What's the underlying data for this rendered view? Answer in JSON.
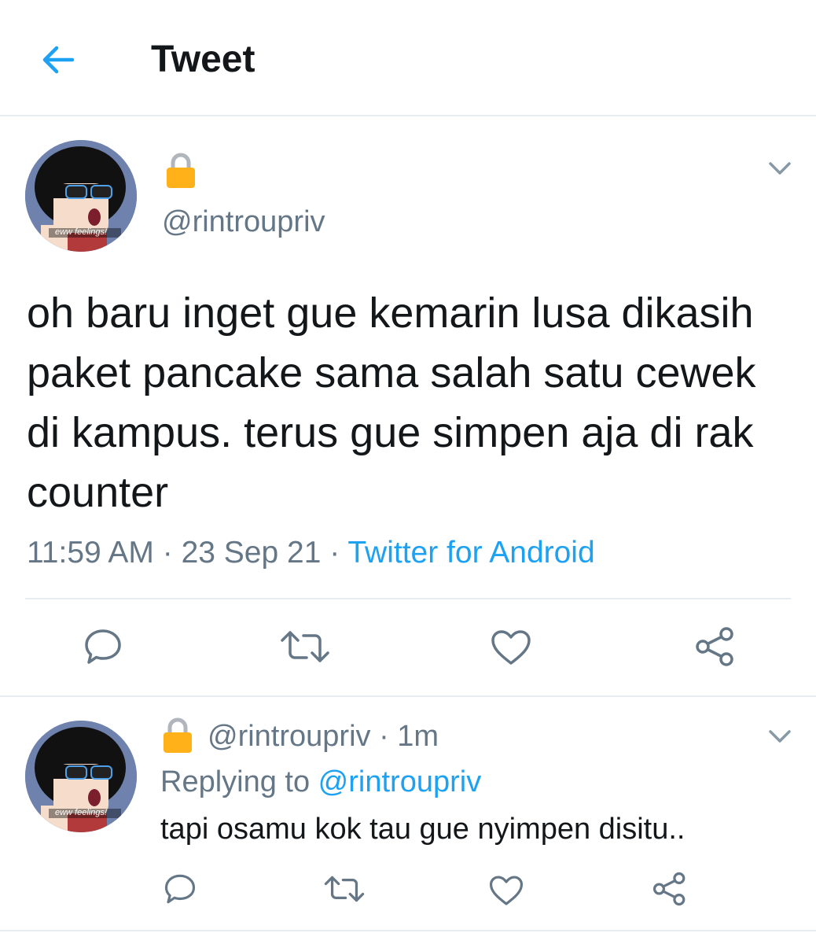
{
  "header": {
    "title": "Tweet",
    "back_icon": "arrow-left-icon"
  },
  "tweet": {
    "author_handle": "@rintroupriv",
    "avatar_caption": "eww feelings!",
    "text": "oh baru inget gue kemarin lusa dikasih paket pancake sama salah satu cewek di kampus. terus gue simpen aja di rak counter",
    "time": "11:59 AM",
    "date": "23 Sep 21",
    "source": "Twitter for Android",
    "separator": " · "
  },
  "reply": {
    "author_handle": "@rintroupriv",
    "age": "1m",
    "separator": " · ",
    "replying_prefix": "Replying to ",
    "replying_to": "@rintroupriv",
    "text": "tapi osamu kok tau gue nyimpen disitu.."
  },
  "colors": {
    "accent": "#1da1f2",
    "secondary_text": "#657786",
    "divider": "#e6ecf0"
  }
}
